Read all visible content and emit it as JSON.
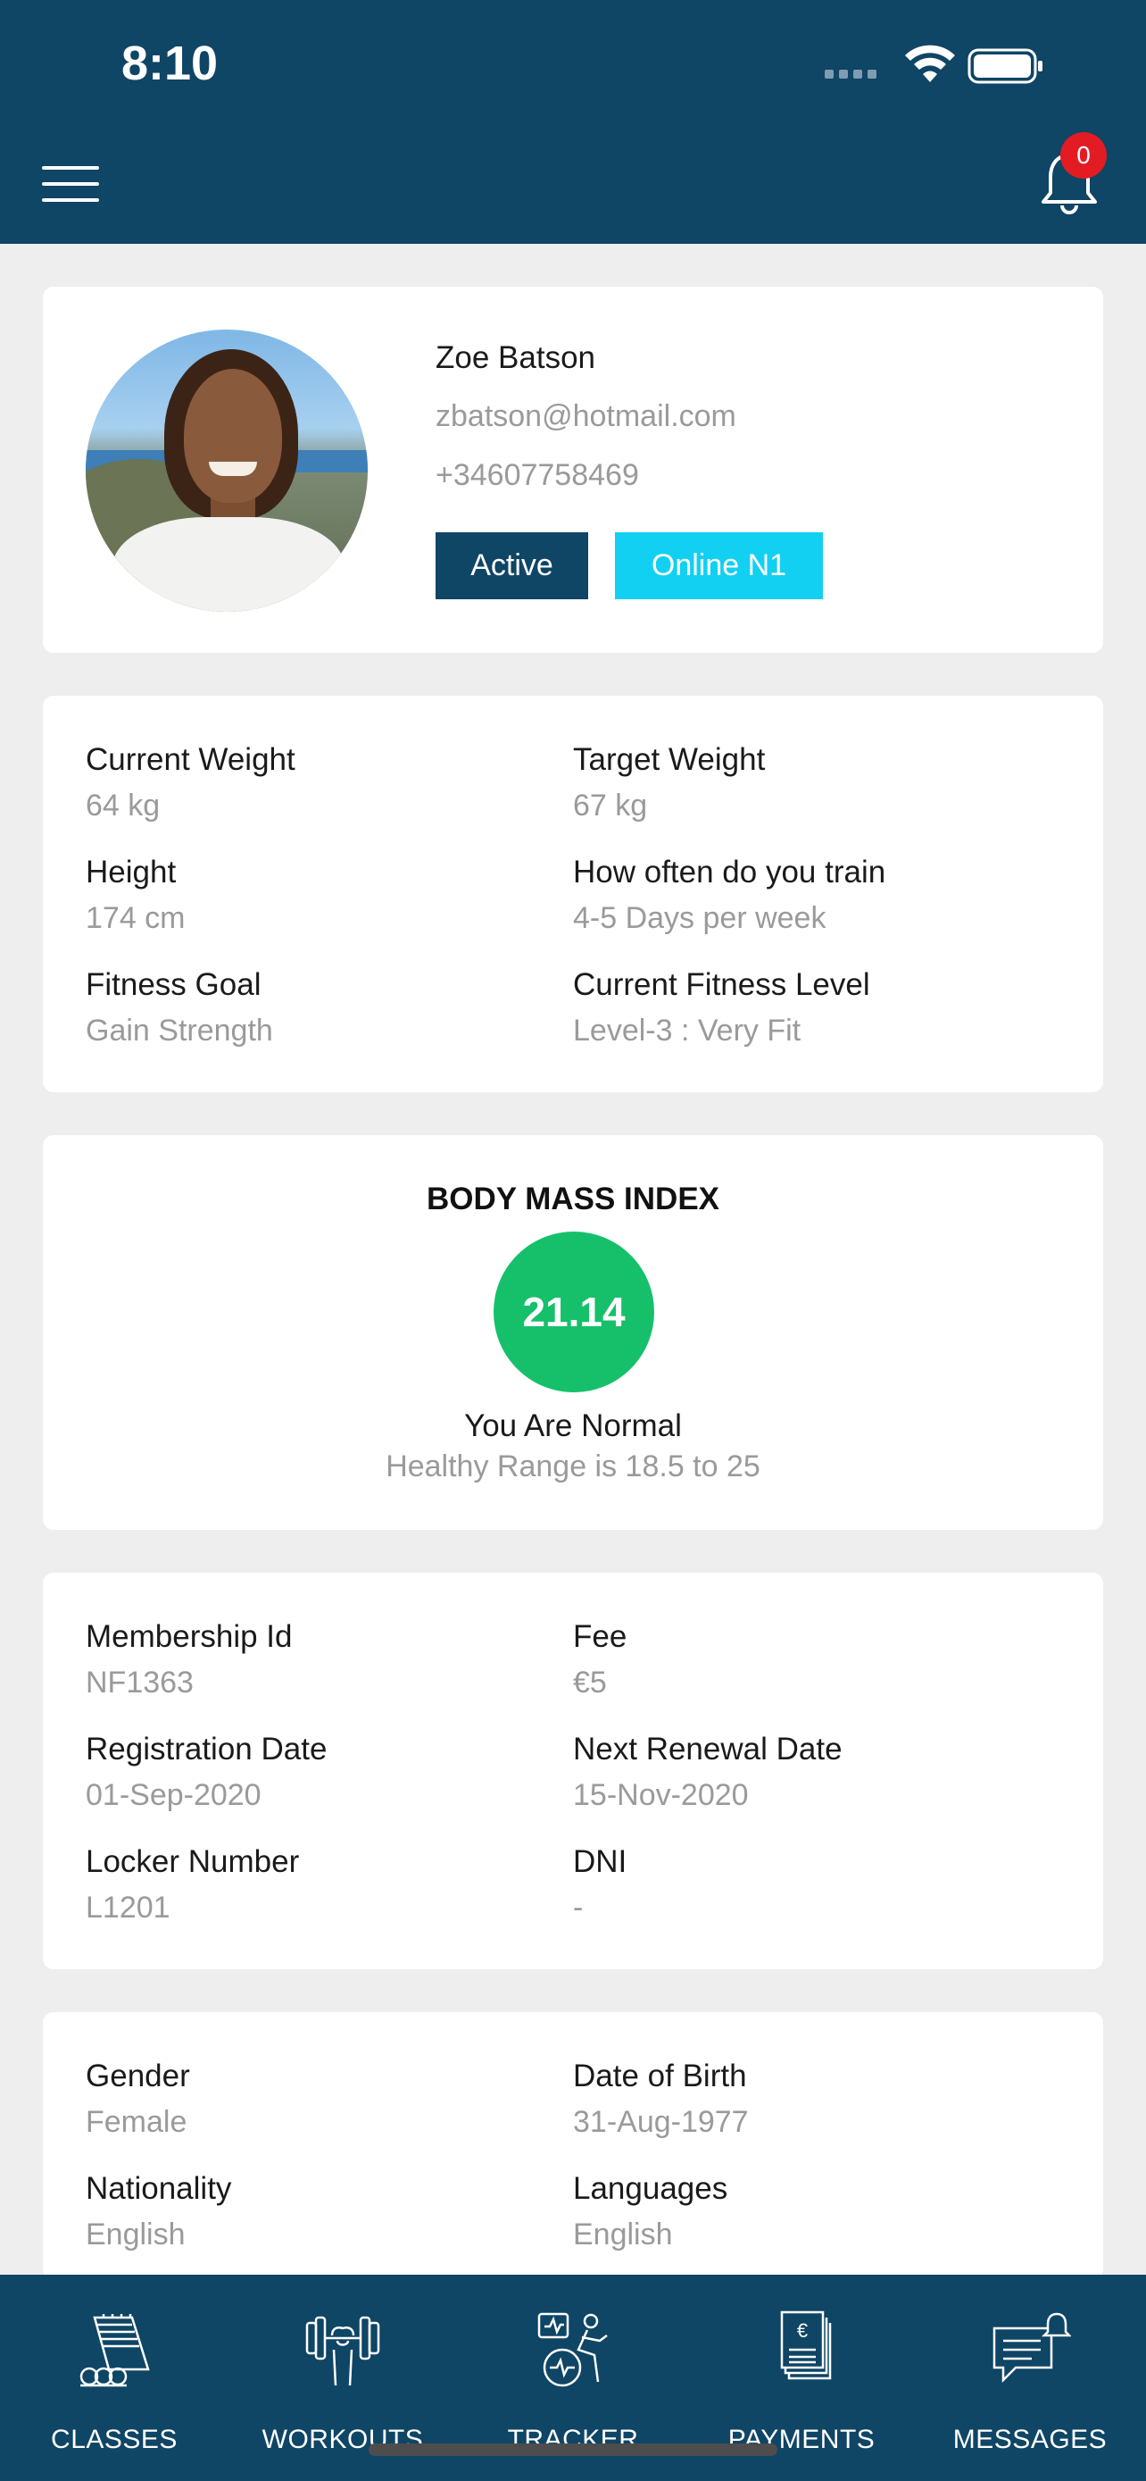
{
  "status_bar": {
    "time": "8:10"
  },
  "header": {
    "notification_count": "0"
  },
  "profile": {
    "name": "Zoe Batson",
    "email": "zbatson@hotmail.com",
    "phone": "+34607758469",
    "status_badge": "Active",
    "plan_badge": "Online N1"
  },
  "stats": {
    "current_weight_label": "Current Weight",
    "current_weight_value": "64 kg",
    "target_weight_label": "Target Weight",
    "target_weight_value": "67 kg",
    "height_label": "Height",
    "height_value": "174 cm",
    "train_freq_label": "How often do you train",
    "train_freq_value": "4-5 Days per week",
    "fitness_goal_label": "Fitness Goal",
    "fitness_goal_value": "Gain Strength",
    "fitness_level_label": "Current Fitness Level",
    "fitness_level_value": "Level-3 : Very Fit"
  },
  "bmi": {
    "title": "BODY MASS INDEX",
    "value": "21.14",
    "status": "You Are Normal",
    "range": "Healthy Range is 18.5 to 25",
    "color": "#16c06a"
  },
  "membership": {
    "id_label": "Membership Id",
    "id_value": "NF1363",
    "fee_label": "Fee",
    "fee_value": "€5",
    "reg_label": "Registration Date",
    "reg_value": "01-Sep-2020",
    "renew_label": "Next Renewal Date",
    "renew_value": "15-Nov-2020",
    "locker_label": "Locker Number",
    "locker_value": "L1201",
    "dni_label": "DNI",
    "dni_value": "-"
  },
  "personal": {
    "gender_label": "Gender",
    "gender_value": "Female",
    "dob_label": "Date of Birth",
    "dob_value": "31-Aug-1977",
    "nationality_label": "Nationality",
    "nationality_value": "English",
    "languages_label": "Languages",
    "languages_value": "English"
  },
  "bottom_nav": {
    "classes": "CLASSES",
    "workouts": "WORKOUTS",
    "tracker": "TRACKER",
    "payments": "PAYMENTS",
    "messages": "MESSAGES"
  },
  "colors": {
    "header_bg": "#0f4565",
    "active_badge": "#0f4565",
    "plan_badge": "#12d0f2",
    "notification_badge": "#e31b23"
  }
}
